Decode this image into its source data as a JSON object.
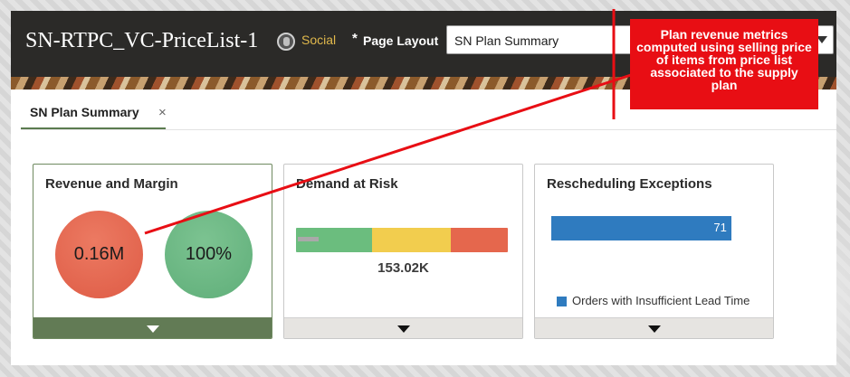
{
  "header": {
    "app_title": "SN-RTPC_VC-PriceList-1",
    "social_label": "Social",
    "page_layout": {
      "required_mark": "*",
      "label": "Page Layout",
      "value": "SN Plan Summary"
    }
  },
  "tabs": [
    {
      "label": "SN Plan Summary",
      "close_glyph": "×",
      "active": true
    }
  ],
  "cards": {
    "revenue": {
      "title": "Revenue and Margin",
      "revenue_value": "0.16M",
      "margin_value": "100%",
      "revenue_color": "#e0604a",
      "margin_color": "#66b37f"
    },
    "demand": {
      "title": "Demand at Risk",
      "value": "153.02K",
      "segments": [
        {
          "status": "on-time",
          "color": "#6bbd7e",
          "share": 0.36
        },
        {
          "status": "at-risk",
          "color": "#f2cd4e",
          "share": 0.37
        },
        {
          "status": "late",
          "color": "#e5674d",
          "share": 0.27
        }
      ],
      "indicator_color": "#a9a9a9",
      "indicator_share": 0.1
    },
    "rescheduling": {
      "title": "Rescheduling Exceptions",
      "bar_value": "71",
      "bar_share": 0.85,
      "bar_color": "#2f7bbf",
      "legend_label": "Orders with Insufficient Lead Time"
    }
  },
  "annotation": {
    "text": "Plan revenue metrics computed using selling price of items from price list associated to the supply plan",
    "color": "#e80e14"
  }
}
